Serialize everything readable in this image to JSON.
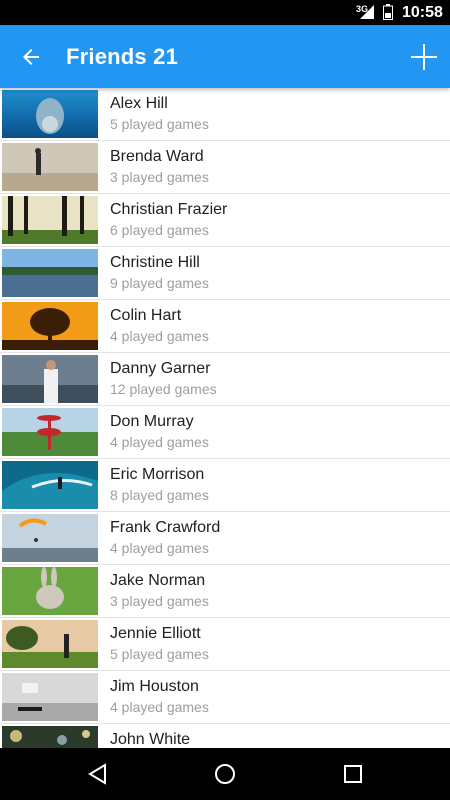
{
  "status_bar": {
    "network": "3G",
    "time": "10:58"
  },
  "app_bar": {
    "title": "Friends 21"
  },
  "friends": [
    {
      "name": "Alex Hill",
      "games": "5 played games",
      "thumb": "dolphin"
    },
    {
      "name": "Brenda Ward",
      "games": "3 played games",
      "thumb": "runner"
    },
    {
      "name": "Christian Frazier",
      "games": "6 played games",
      "thumb": "forest"
    },
    {
      "name": "Christine Hill",
      "games": "9 played games",
      "thumb": "lake"
    },
    {
      "name": "Colin Hart",
      "games": "4 played games",
      "thumb": "sunset-tree"
    },
    {
      "name": "Danny Garner",
      "games": "12 played games",
      "thumb": "man-harbor"
    },
    {
      "name": "Don Murray",
      "games": "4 played games",
      "thumb": "disc-golf"
    },
    {
      "name": "Eric Morrison",
      "games": "8 played games",
      "thumb": "surfer"
    },
    {
      "name": "Frank Crawford",
      "games": "4 played games",
      "thumb": "paraglider"
    },
    {
      "name": "Jake Norman",
      "games": "3 played games",
      "thumb": "rabbit"
    },
    {
      "name": "Jennie Elliott",
      "games": "5 played games",
      "thumb": "park"
    },
    {
      "name": "Jim Houston",
      "games": "4 played games",
      "thumb": "skateboarder"
    },
    {
      "name": "John White",
      "games": "",
      "thumb": "bokeh"
    }
  ],
  "colors": {
    "primary": "#2196F3",
    "status_bar": "#000000",
    "secondary_text": "#9e9e9e"
  }
}
